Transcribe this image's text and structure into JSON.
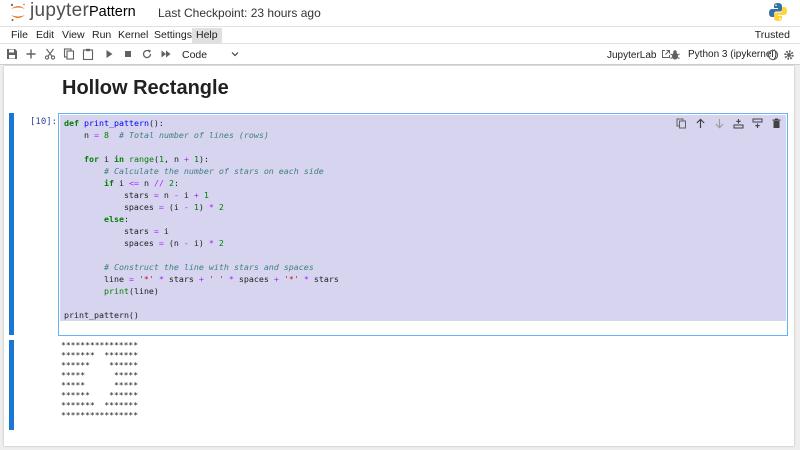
{
  "header": {
    "logo_text": "jupyter",
    "notebook_name": "Pattern",
    "checkpoint": "Last Checkpoint: 23 hours ago",
    "icons": [
      "jupyter-logo-icon",
      "python-logo-icon"
    ]
  },
  "menubar": {
    "items": [
      "File",
      "Edit",
      "View",
      "Run",
      "Kernel",
      "Settings",
      "Help"
    ],
    "trusted": "Trusted"
  },
  "toolbar": {
    "icons": [
      "save-icon",
      "plus-icon",
      "cut-icon",
      "copy-icon",
      "paste-icon",
      "run-icon",
      "stop-icon",
      "restart-icon",
      "fast-forward-icon"
    ],
    "cell_type": "Code",
    "jupyterlab_link": "JupyterLab",
    "kernel": "Python 3 (ipykernel)"
  },
  "notebook": {
    "heading": "Hollow Rectangle",
    "cell": {
      "prompt": "[10]:",
      "code_lines": [
        "def print_pattern():",
        "    n = 8  # Total number of lines (rows)",
        "",
        "    for i in range(1, n + 1):",
        "        # Calculate the number of stars on each side",
        "        if i <= n // 2:",
        "            stars = n - i + 1",
        "            spaces = (i - 1) * 2",
        "        else:",
        "            stars = i",
        "            spaces = (n - i) * 2",
        "",
        "        # Construct the line with stars and spaces",
        "        line = '*' * stars + ' ' * spaces + '*' * stars",
        "        print(line)",
        "",
        "print_pattern()"
      ],
      "output_lines": [
        "****************",
        "*******  *******",
        "******    ******",
        "*****      *****",
        "*****      *****",
        "******    ******",
        "*******  *******",
        "****************"
      ]
    }
  },
  "colors": {
    "accent": "#1976d2",
    "cell_selected_bg": "#d7d4f0",
    "jupyter_orange": "#f37726"
  }
}
